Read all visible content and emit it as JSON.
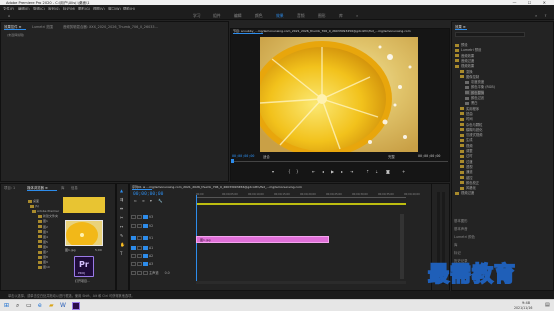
{
  "app": {
    "title": "Adobe Premiere Pro 2020 - C:\\用户\\Ulis(:\\桌面\\1",
    "window_controls": "— ☐ ✕"
  },
  "menu": [
    "文件(F)",
    "编辑(E)",
    "剪辑(C)",
    "序列(S)",
    "标记(M)",
    "图形(G)",
    "视图(V)",
    "窗口(W)",
    "帮助(H)"
  ],
  "workspaces": [
    "学习",
    "组件",
    "编辑",
    "颜色",
    "效果",
    "音频",
    "图形",
    "库",
    "»"
  ],
  "active_workspace": "效果",
  "source_panel": {
    "tabs": [
      "效果控件 ≡",
      "Lumetri 范围",
      "音频剪辑混合器: XXX_2020_2026_Thumb_706_0_26033..."
    ],
    "subtitle": "(未选择剪辑)"
  },
  "program": {
    "tab": "节目: scoubby_...mg/lemonunsing.com_2021_2026_thumb_706_0_26033093456@gdcolfm/fsd_...mg/lemonunsing.com",
    "timecode": "00;00;00;00",
    "fit": "适合",
    "quality": "完整",
    "duration": "00;00;00;00"
  },
  "effects_panel": {
    "tab": "效果 ≡",
    "search_placeholder": "",
    "items": [
      {
        "label": "预设",
        "level": 0
      },
      {
        "label": "Lumetri 预设",
        "level": 0
      },
      {
        "label": "音频效果",
        "level": 0
      },
      {
        "label": "音频过渡",
        "level": 0
      },
      {
        "label": "视频效果",
        "level": 0
      },
      {
        "label": "变换",
        "level": 1
      },
      {
        "label": "图像控制",
        "level": 1
      },
      {
        "label": "灰度亮度",
        "level": 2
      },
      {
        "label": "颜色平衡 (RGB)",
        "level": 2
      },
      {
        "label": "颜色替换",
        "level": 2
      },
      {
        "label": "颜色过滤",
        "level": 2
      },
      {
        "label": "黑白",
        "level": 2
      },
      {
        "label": "实用程序",
        "level": 1
      },
      {
        "label": "扭曲",
        "level": 1
      },
      {
        "label": "时间",
        "level": 1
      },
      {
        "label": "杂色与颗粒",
        "level": 1
      },
      {
        "label": "模糊与锐化",
        "level": 1
      },
      {
        "label": "沉浸式视频",
        "level": 1
      },
      {
        "label": "生成",
        "level": 1
      },
      {
        "label": "视频",
        "level": 1
      },
      {
        "label": "调整",
        "level": 1
      },
      {
        "label": "过时",
        "level": 1
      },
      {
        "label": "过渡",
        "level": 1
      },
      {
        "label": "透视",
        "level": 1
      },
      {
        "label": "通道",
        "level": 1
      },
      {
        "label": "键控",
        "level": 1
      },
      {
        "label": "颜色校正",
        "level": 1
      },
      {
        "label": "风格化",
        "level": 1
      },
      {
        "label": "视频过渡",
        "level": 0
      }
    ],
    "bottom_tabs": [
      "基本图形",
      "基本声音",
      "Lumetri 颜色",
      "库",
      "标记",
      "历史记录",
      "信息"
    ]
  },
  "project_panel": {
    "tabs": [
      "项目: 1",
      "媒体浏览器 ≡",
      "库",
      "信息"
    ],
    "folders": [
      "桌面",
      "JSJ",
      "Adobe Premier",
      "新建文件夹",
      "图1",
      "图2",
      "图3",
      "图4",
      "图5",
      "图6",
      "图7",
      "图8",
      "图9",
      "图10"
    ],
    "clip_name": "图1.jpg",
    "clip_duration": "5;00",
    "pr_label": "Pr",
    "pr_sub": "PROJ",
    "pr_file": "打开项目..."
  },
  "timeline": {
    "tab": "序列01 ≡ ...mg/lemonunsing.com_2021_2026_thumb_706_0_26033093456@gdcolfm/fsd_...mg/lemonunsing.com",
    "timecode": "00;00;00;00",
    "ruler": [
      "00;00",
      "00;00;05;00",
      "00;00;10;00",
      "00;00;15;00",
      "00;00;20;00",
      "00;00;25;00",
      "00;00;30;00",
      "00;00;35;00",
      "00;00;40;00"
    ],
    "tracks": [
      "V3",
      "V2",
      "V1",
      "A1",
      "A2",
      "A3",
      "主声道"
    ],
    "master_value": "0.0",
    "clip_label": "图1.jpg"
  },
  "status_bar": "单击以选择，或单击空白处并拖动以进行框选。使用 Shift、Alt 和 Ctrl 可获得其他选项。",
  "taskbar": {
    "time": "9:48",
    "date": "2021/11/16"
  },
  "watermark": "最需教育",
  "colors": {
    "accent": "#2d8ceb",
    "clip": "#e070d8",
    "folder": "#a88a2c"
  }
}
